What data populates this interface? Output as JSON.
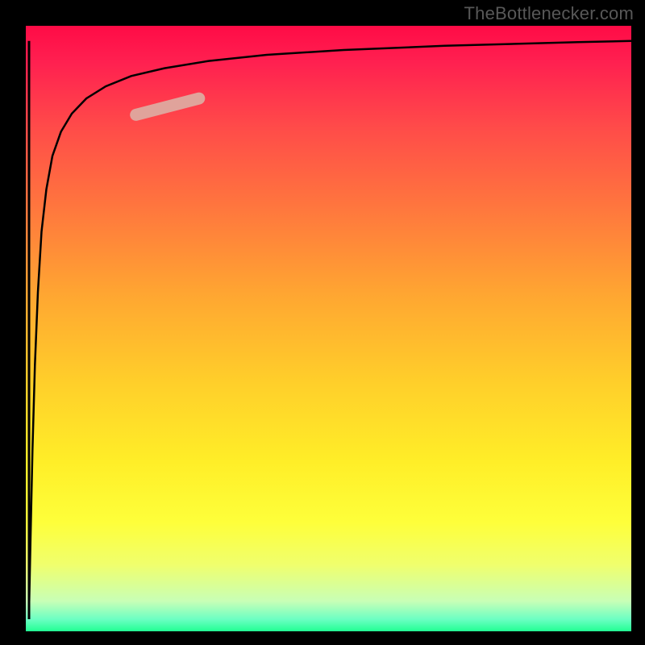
{
  "watermark": "TheBottlenecker.com",
  "chart_data": {
    "type": "line",
    "title": "",
    "xlabel": "",
    "ylabel": "",
    "xlim": [
      0,
      100
    ],
    "ylim": [
      0,
      100
    ],
    "background_gradient": {
      "direction": "vertical",
      "stops": [
        {
          "pos": 0.0,
          "color": "#ff0b46"
        },
        {
          "pos": 0.5,
          "color": "#ffc02c"
        },
        {
          "pos": 0.85,
          "color": "#f9ff4a"
        },
        {
          "pos": 1.0,
          "color": "#22ff93"
        }
      ]
    },
    "series": [
      {
        "name": "curve",
        "color": "#000000",
        "stroke_width": 2.5,
        "x": [
          0.5,
          0.8,
          1.1,
          1.5,
          2.0,
          2.6,
          3.4,
          4.4,
          5.8,
          7.6,
          10.0,
          13.2,
          17.4,
          22.9,
          30.2,
          39.8,
          52.5,
          69.2,
          91.2,
          100.0
        ],
        "y": [
          2.0,
          16.0,
          30.0,
          44.0,
          56.0,
          66.0,
          73.0,
          78.5,
          82.5,
          85.5,
          88.0,
          90.0,
          91.7,
          93.0,
          94.2,
          95.2,
          96.0,
          96.7,
          97.3,
          97.5
        ]
      },
      {
        "name": "vertical-bar",
        "color": "#000000",
        "stroke_width": 3,
        "x": [
          0.53,
          0.53
        ],
        "y": [
          2.0,
          97.5
        ]
      }
    ],
    "highlight": {
      "color": "#e0a39b",
      "stroke_width": 15,
      "linecap": "round",
      "x": [
        18.2,
        28.6
      ],
      "y": [
        85.3,
        88.0
      ]
    }
  }
}
